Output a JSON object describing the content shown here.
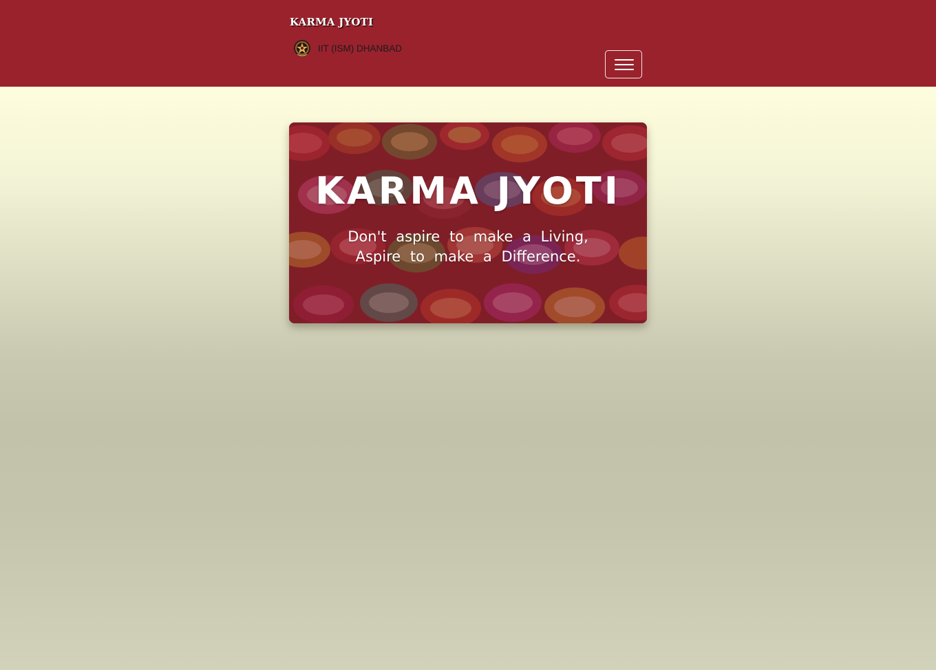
{
  "navbar": {
    "brand": "KARMA JYOTI",
    "org_name": "IIT (ISM) DHANBAD",
    "logo_icon": "institute-emblem-icon",
    "menu_icon": "hamburger-menu-icon",
    "background_color": "#9a222d"
  },
  "hero": {
    "title": "KARMA JYOTI",
    "tagline_line1": "Don't aspire to make a Living,",
    "tagline_line2": "Aspire to make a Difference.",
    "background_image": "painted-clay-diyas"
  }
}
